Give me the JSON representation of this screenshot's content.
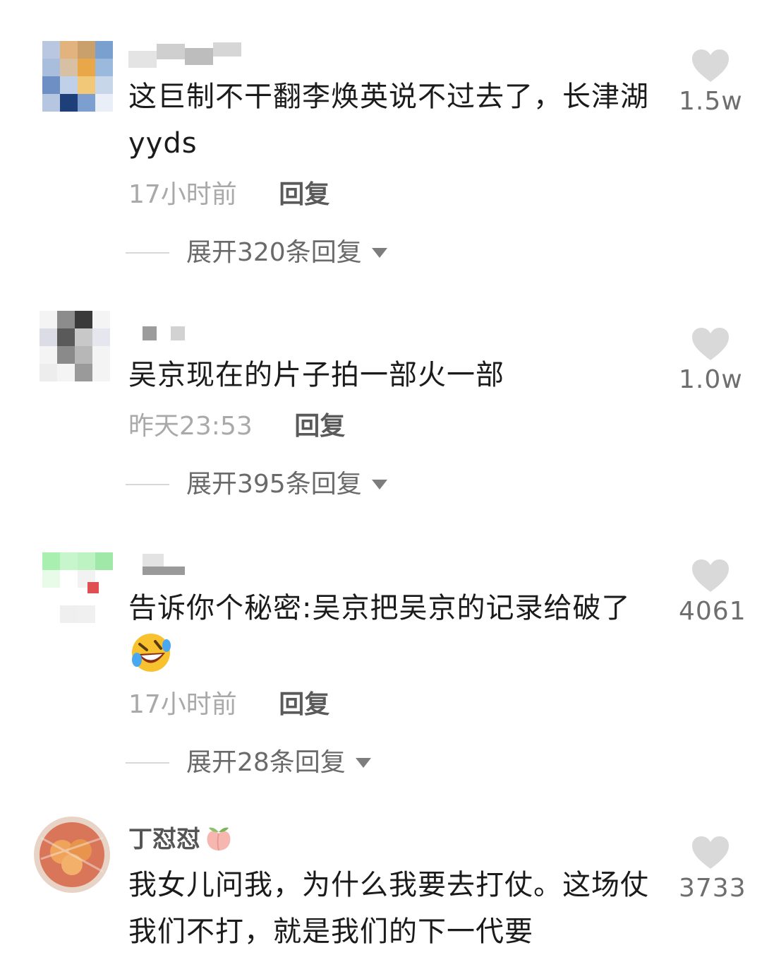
{
  "comments": [
    {
      "text": "这巨制不干翻李焕英说不过去了，长津湖yyds",
      "time": "17小时前",
      "reply": "回复",
      "expand": "展开320条回复",
      "likes": "1.5w"
    },
    {
      "text": "吴京现在的片子拍一部火一部",
      "time": "昨天23:53",
      "reply": "回复",
      "expand": "展开395条回复",
      "likes": "1.0w"
    },
    {
      "text": "告诉你个秘密:吴京把吴京的记录给破了",
      "emoji": "rofl-emoji",
      "time": "17小时前",
      "reply": "回复",
      "expand": "展开28条回复",
      "likes": "4061"
    },
    {
      "username": "丁怼怼",
      "username_emoji": "peach-emoji",
      "text": "我女儿问我，为什么我要去打仗。这场仗我们不打，就是我们的下一代要",
      "likes": "3733"
    }
  ],
  "icons": {
    "like": "heart-icon",
    "caret": "caret-down-icon"
  },
  "colors": {
    "heart": "#d9d9d9",
    "time": "#a9a9a9",
    "reply": "#5a5a5a"
  }
}
